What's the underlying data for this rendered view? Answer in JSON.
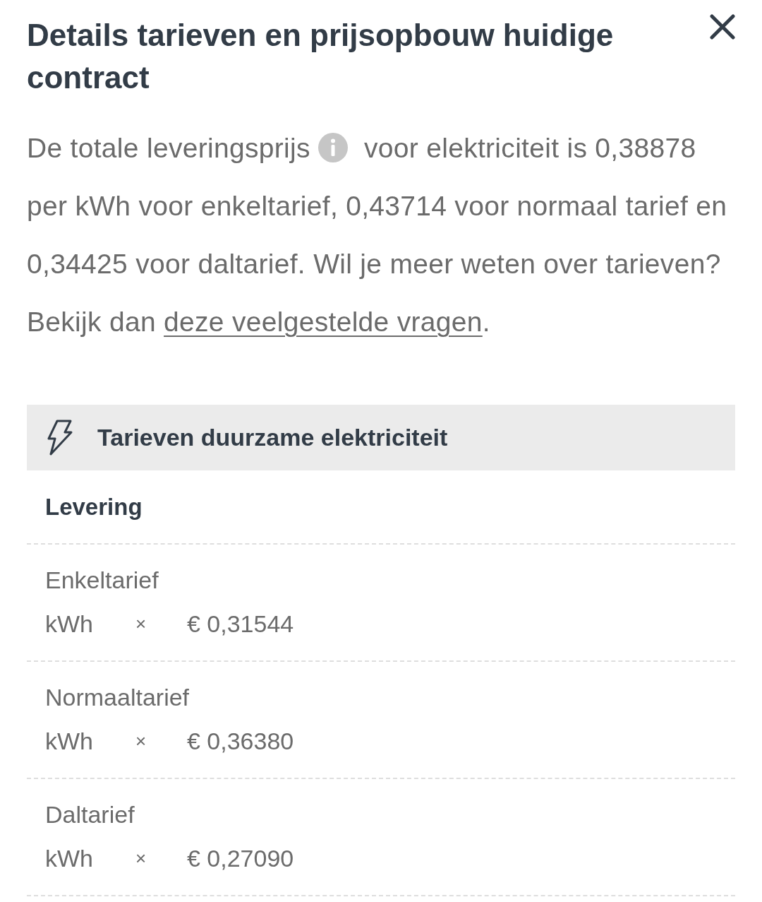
{
  "dialog": {
    "title": "Details tarieven en prijsopbouw huidige contract"
  },
  "intro": {
    "lead": "De totale leveringsprijs",
    "body": "voor elektriciteit is 0,38878 per kWh voor enkeltarief, 0,43714 voor normaal tarief en 0,34425 voor daltarief. Wil je meer weten over tarieven? Bekijk dan",
    "link": "deze veelgestelde vragen",
    "end": "."
  },
  "rates_section": {
    "title": "Tarieven duurzame elektriciteit",
    "subtitle": "Levering",
    "rates": [
      {
        "name": "Enkeltarief",
        "unit": "kWh",
        "operator": "×",
        "price": "€ 0,31544"
      },
      {
        "name": "Normaaltarief",
        "unit": "kWh",
        "operator": "×",
        "price": "€ 0,36380"
      },
      {
        "name": "Daltarief",
        "unit": "kWh",
        "operator": "×",
        "price": "€ 0,27090"
      }
    ]
  }
}
